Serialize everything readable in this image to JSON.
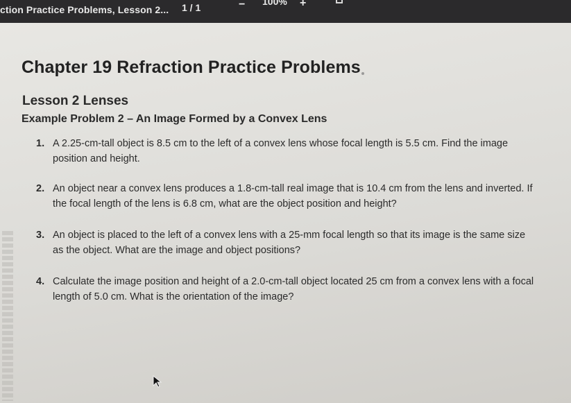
{
  "toolbar": {
    "doc_title": "ction Practice Problems, Lesson 2...",
    "page_indicator": "1 / 1",
    "zoom": "100%",
    "zoom_out_symbol": "−",
    "zoom_in_symbol": "+"
  },
  "document": {
    "chapter_title": "Chapter 19 Refraction Practice Problems",
    "lesson_title": "Lesson 2 Lenses",
    "example_title": "Example Problem 2 – An Image Formed by a Convex Lens",
    "problems": [
      {
        "num": "1.",
        "text": "A 2.25-cm-tall object is 8.5 cm to the left of a convex lens whose focal length is 5.5 cm. Find the image position and height."
      },
      {
        "num": "2.",
        "text": "An object near a convex lens produces a 1.8-cm-tall real image that is 10.4 cm from the lens and inverted. If the focal length of the lens is 6.8 cm, what are the object position and height?"
      },
      {
        "num": "3.",
        "text": "An object is placed to the left of a convex lens with a 25-mm focal length so that its image is the same size as the object. What are the image and object positions?"
      },
      {
        "num": "4.",
        "text": "Calculate the image position and height of a 2.0-cm-tall object located 25 cm from a convex lens with a focal length of 5.0 cm. What is the orientation of the image?"
      }
    ]
  },
  "icons": {
    "fit": "fit-page-icon",
    "cursor": "mouse-cursor-icon"
  }
}
